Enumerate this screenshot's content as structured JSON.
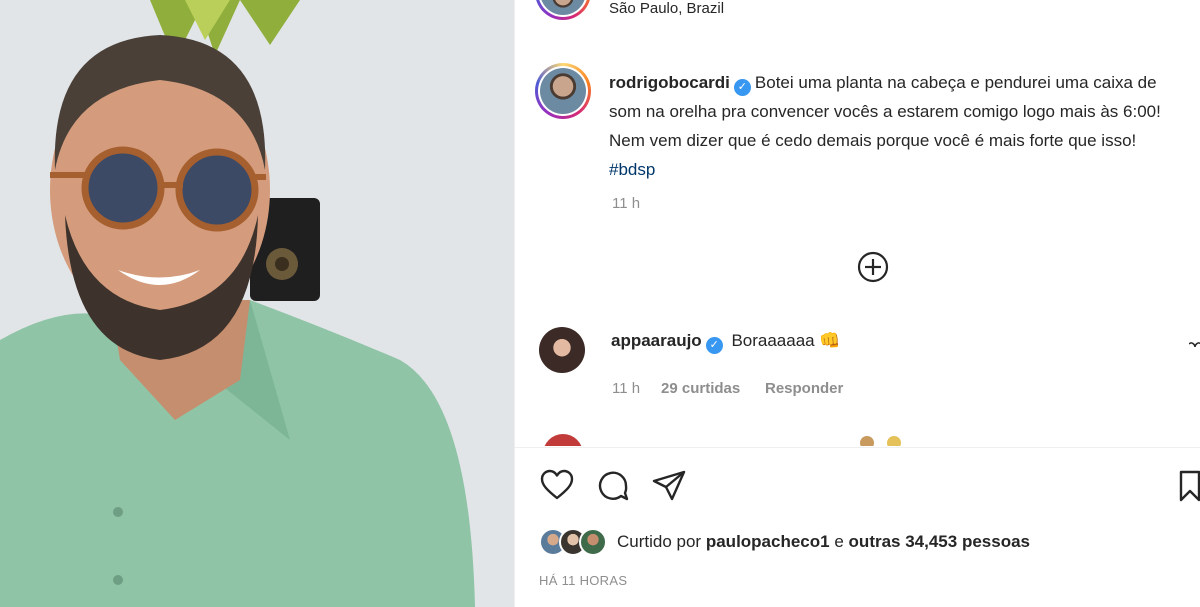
{
  "post": {
    "location": "São Paulo, Brazil",
    "author": "rodrigobocardi",
    "caption": "Botei uma planta na cabeça e pendurei uma caixa de som na orelha pra convencer vocês a estarem comigo logo mais às 6:00! Nem vem dizer que é cedo demais porque você é mais forte que isso!",
    "hashtag": "#bdsp",
    "caption_time": "11 h"
  },
  "comment": {
    "author": "appaaraujo",
    "text": "Boraaaaaa",
    "emoji": "👊",
    "time": "11 h",
    "likes": "29 curtidas",
    "reply": "Responder"
  },
  "likes": {
    "prefix": "Curtido por",
    "user": "paulopacheco1",
    "middle": "e",
    "others": "outras 34,453 pessoas"
  },
  "timestamp": "HÁ 11 HORAS",
  "icons": [
    "heart-icon",
    "comment-icon",
    "share-icon",
    "bookmark-icon",
    "add-comment-icon",
    "verified-icon"
  ]
}
